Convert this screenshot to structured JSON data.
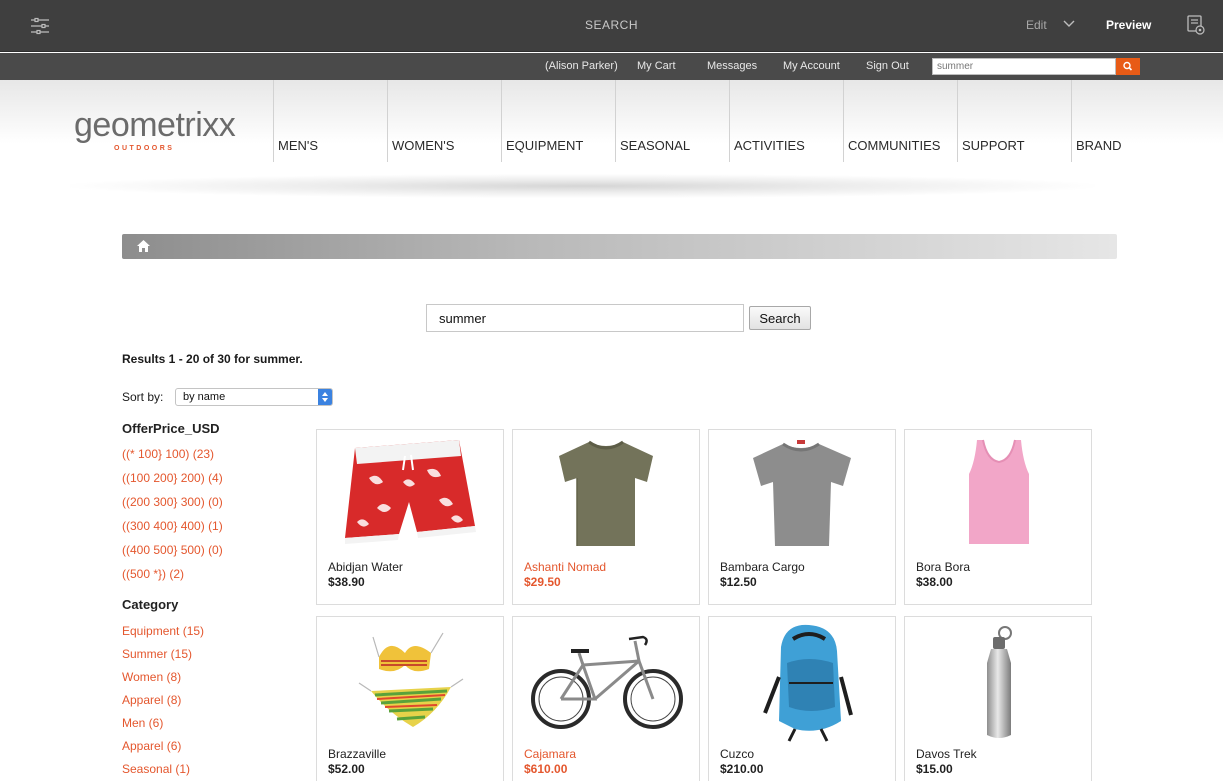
{
  "editor": {
    "page_title": "SEARCH",
    "mode_label": "Edit",
    "preview_label": "Preview"
  },
  "user_nav": {
    "user_name": "(Alison Parker)",
    "my_cart": "My Cart",
    "messages": "Messages",
    "my_account": "My Account",
    "sign_out": "Sign Out",
    "search_value": "summer"
  },
  "logo": {
    "name": "geometrixx",
    "tagline": "OUTDOORS"
  },
  "main_nav": [
    "MEN'S",
    "WOMEN'S",
    "EQUIPMENT",
    "SEASONAL",
    "ACTIVITIES",
    "COMMUNITIES",
    "SUPPORT",
    "BRAND"
  ],
  "search": {
    "query": "summer",
    "button_label": "Search",
    "results_summary": "Results 1 - 20 of 30 for summer."
  },
  "sort": {
    "label": "Sort by:",
    "selected": "by name"
  },
  "facets": {
    "price_title": "OfferPrice_USD",
    "price_items": [
      "((* 100} 100) (23)",
      "((100 200} 200) (4)",
      "((200 300} 300) (0)",
      "((300 400} 400) (1)",
      "((400 500} 500) (0)",
      "((500 *}) (2)"
    ],
    "category_title": "Category",
    "category_items": [
      "Equipment (15)",
      "Summer (15)",
      "Women (8)",
      "Apparel (8)",
      "Men (6)",
      "Apparel (6)",
      "Seasonal (1)"
    ]
  },
  "products": [
    {
      "name": "Abidjan Water",
      "price": "$38.90",
      "highlighted": false,
      "icon": "swim-shorts-image"
    },
    {
      "name": "Ashanti Nomad",
      "price": "$29.50",
      "highlighted": true,
      "icon": "olive-tshirt-image"
    },
    {
      "name": "Bambara Cargo",
      "price": "$12.50",
      "highlighted": false,
      "icon": "grey-tshirt-image"
    },
    {
      "name": "Bora Bora",
      "price": "$38.00",
      "highlighted": false,
      "icon": "pink-tank-top-image"
    },
    {
      "name": "Brazzaville",
      "price": "$52.00",
      "highlighted": false,
      "icon": "bikini-image"
    },
    {
      "name": "Cajamara",
      "price": "$610.00",
      "highlighted": true,
      "icon": "bicycle-image"
    },
    {
      "name": "Cuzco",
      "price": "$210.00",
      "highlighted": false,
      "icon": "backpack-image"
    },
    {
      "name": "Davos Trek",
      "price": "$15.00",
      "highlighted": false,
      "icon": "water-bottle-image"
    }
  ],
  "colors": {
    "accent": "#e4572e",
    "editor_bar": "#3f3f3f",
    "user_bar": "#4a4a4a",
    "search_button": "#e85b16"
  }
}
